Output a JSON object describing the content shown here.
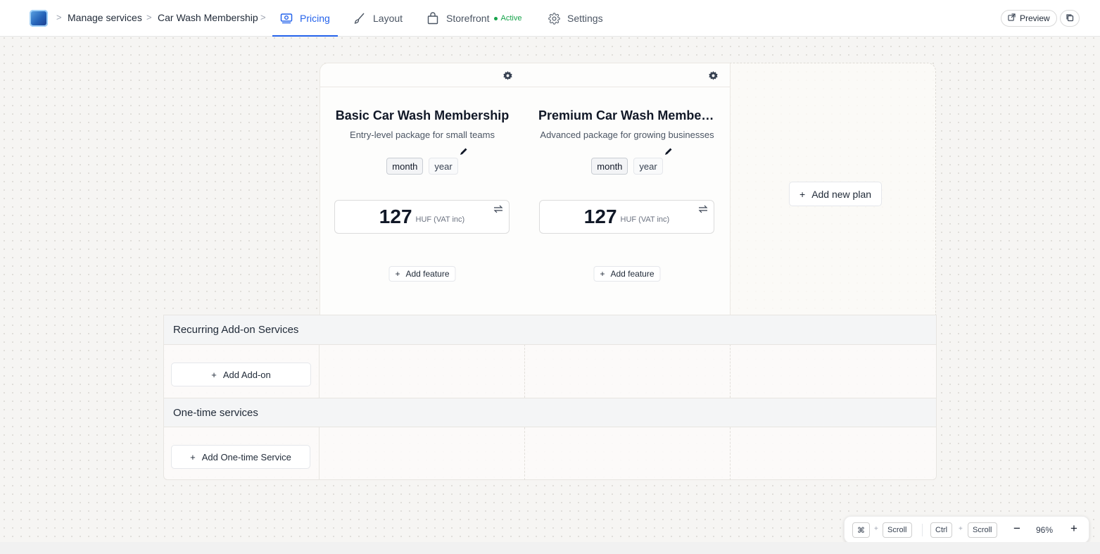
{
  "breadcrumb": {
    "items": [
      "Manage services",
      "Car Wash Membership"
    ]
  },
  "tabs": [
    {
      "label": "Pricing",
      "icon": "pricing-icon",
      "active": true
    },
    {
      "label": "Layout",
      "icon": "brush-icon",
      "active": false
    },
    {
      "label": "Storefront",
      "icon": "bag-icon",
      "active": false,
      "status": "Active"
    },
    {
      "label": "Settings",
      "icon": "gear-icon",
      "active": false
    }
  ],
  "toolbar": {
    "preview_label": "Preview"
  },
  "plans": [
    {
      "title": "Basic Car Wash Membership",
      "description": "Entry-level package for small teams",
      "periods": [
        "month",
        "year"
      ],
      "selected_period": "month",
      "price": "127",
      "price_unit": "HUF (VAT inc)",
      "add_feature_label": "Add feature"
    },
    {
      "title": "Premium Car Wash Member...",
      "description": "Advanced package for growing businesses",
      "periods": [
        "month",
        "year"
      ],
      "selected_period": "month",
      "price": "127",
      "price_unit": "HUF (VAT inc)",
      "add_feature_label": "Add feature"
    }
  ],
  "add_plan_label": "Add new plan",
  "sections": [
    {
      "title": "Recurring Add-on Services",
      "add_label": "Add Add-on"
    },
    {
      "title": "One-time services",
      "add_label": "Add One-time Service"
    }
  ],
  "zoom": {
    "key_cmd": "⌘",
    "key_scroll": "Scroll",
    "key_ctrl": "Ctrl",
    "plus": "+",
    "level": "96%"
  },
  "colors": {
    "accent": "#2563eb",
    "status_active": "#16a34a"
  }
}
